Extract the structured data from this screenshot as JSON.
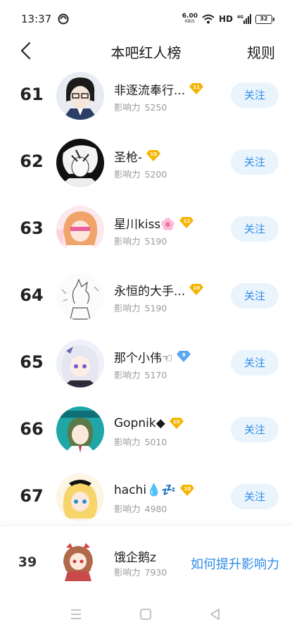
{
  "status": {
    "time": "13:37",
    "net_speed_value": "6.00",
    "net_speed_unit": "KB/S",
    "hd": "HD",
    "battery": "32"
  },
  "header": {
    "title": "本吧红人榜",
    "rules": "规则"
  },
  "influence_label": "影响力",
  "rows": [
    {
      "rank": "61",
      "name": "非逐流奉行...",
      "level": "11",
      "influence": "5250",
      "follow": "关注",
      "badge_color": "#f5b400"
    },
    {
      "rank": "62",
      "name": "圣枪-",
      "level": "10",
      "influence": "5200",
      "follow": "关注",
      "badge_color": "#f5b400"
    },
    {
      "rank": "63",
      "name": "星川kiss🌸",
      "level": "12",
      "influence": "5190",
      "follow": "关注",
      "badge_color": "#f5b400"
    },
    {
      "rank": "64",
      "name": "永恒的大手...",
      "level": "10",
      "influence": "5190",
      "follow": "关注",
      "badge_color": "#f5b400"
    },
    {
      "rank": "65",
      "name": "那个小伟☜",
      "level": "8",
      "influence": "5170",
      "follow": "关注",
      "badge_color": "#5aa7f0"
    },
    {
      "rank": "66",
      "name": "Gopnik◆",
      "level": "10",
      "influence": "5010",
      "follow": "关注",
      "badge_color": "#f5b400"
    },
    {
      "rank": "67",
      "name": "hachi💧💤",
      "level": "10",
      "influence": "4980",
      "follow": "关注",
      "badge_color": "#f5b400"
    }
  ],
  "me": {
    "rank": "39",
    "name": "饿企鹅z",
    "influence": "7930",
    "how_to": "如何提升影响力"
  },
  "colors": {
    "accent": "#2d8ce8",
    "follow_bg": "#eaf4fd",
    "gold_badge": "#f5b400",
    "blue_badge": "#5aa7f0"
  }
}
